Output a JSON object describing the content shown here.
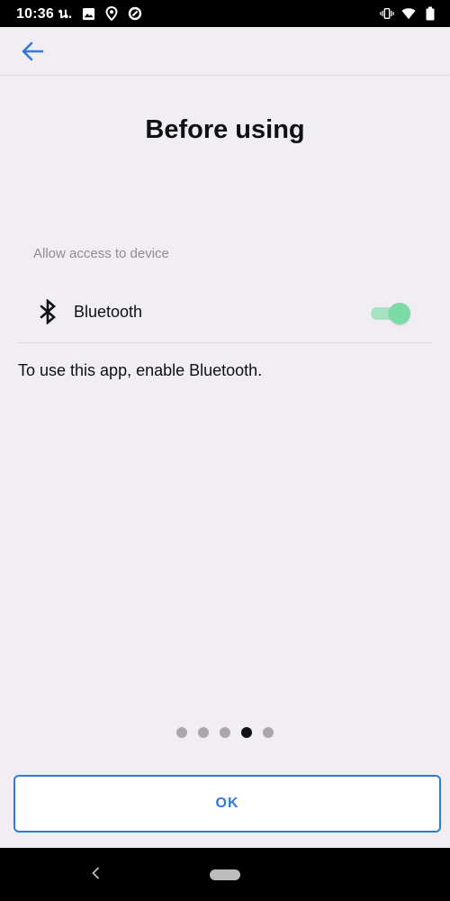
{
  "status_bar": {
    "time": "10:36 น.",
    "icons": [
      "image-icon",
      "location-icon",
      "data-saver-icon",
      "vibrate-icon",
      "wifi-icon",
      "battery-icon"
    ]
  },
  "app_bar": {
    "back_icon": "arrow-left-icon",
    "accent_color": "#2f79d8"
  },
  "main": {
    "title": "Before using",
    "section_label": "Allow access to device",
    "permissions": [
      {
        "icon": "bluetooth-icon",
        "label": "Bluetooth",
        "enabled": true
      }
    ],
    "info_text": "To use this app, enable Bluetooth.",
    "pager": {
      "total": 5,
      "current": 4
    }
  },
  "footer": {
    "ok_label": "OK"
  },
  "nav_bar": {
    "icons": [
      "nav-back-icon",
      "nav-home-pill"
    ]
  }
}
